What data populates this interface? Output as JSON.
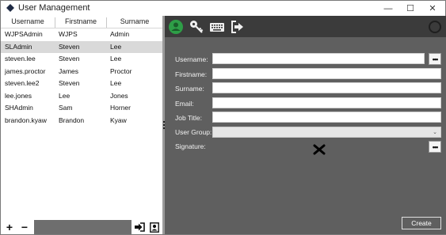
{
  "window": {
    "title": "User Management",
    "controls": {
      "minimize": "—",
      "maximize": "☐",
      "close": "✕"
    }
  },
  "user_list": {
    "columns": [
      "Username",
      "Firstname",
      "Surname"
    ],
    "rows": [
      {
        "username": "WJPSAdmin",
        "firstname": "WJPS",
        "surname": "Admin"
      },
      {
        "username": "SLAdmin",
        "firstname": "Steven",
        "surname": "Lee"
      },
      {
        "username": "steven.lee",
        "firstname": "Steven",
        "surname": "Lee"
      },
      {
        "username": "james.proctor",
        "firstname": "James",
        "surname": "Proctor"
      },
      {
        "username": "steven.lee2",
        "firstname": "Steven",
        "surname": "Lee"
      },
      {
        "username": "lee.jones",
        "firstname": "Lee",
        "surname": "Jones"
      },
      {
        "username": "SHAdmin",
        "firstname": "Sam",
        "surname": "Horner"
      },
      {
        "username": "brandon.kyaw",
        "firstname": "Brandon",
        "surname": "Kyaw"
      }
    ],
    "selected_index": 1
  },
  "list_actions": {
    "add": "+",
    "remove": "−"
  },
  "toolbar": {
    "icons": [
      "user-add-icon",
      "key-icon",
      "keyboard-icon",
      "sign-out-icon",
      "status-ring-icon"
    ]
  },
  "form": {
    "labels": {
      "username": "Username:",
      "firstname": "Firstname:",
      "surname": "Surname:",
      "email": "Email:",
      "job_title": "Job Title:",
      "user_group": "User Group:",
      "signature": "Signature:"
    },
    "values": {
      "username": "",
      "firstname": "",
      "surname": "",
      "email": "",
      "job_title": "",
      "user_group": ""
    },
    "browse_label": "•••",
    "create_label": "Create"
  },
  "colors": {
    "panel": "#5f5f5f",
    "toolbar": "#3b3b3b",
    "accent_green": "#2e9e47",
    "selected_row": "#d9d9d9"
  }
}
